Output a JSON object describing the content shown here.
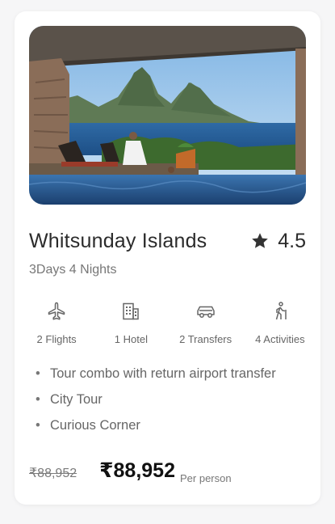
{
  "tour": {
    "title": "Whitsunday Islands",
    "rating": "4.5",
    "duration": "3Days 4 Nights"
  },
  "features": [
    {
      "icon": "airplane-icon",
      "label": "2 Flights"
    },
    {
      "icon": "hotel-icon",
      "label": "1 Hotel"
    },
    {
      "icon": "car-icon",
      "label": "2 Transfers"
    },
    {
      "icon": "hiking-icon",
      "label": "4 Activities"
    }
  ],
  "highlights": [
    "Tour combo with return airport transfer",
    "City Tour",
    "Curious Corner"
  ],
  "pricing": {
    "original": "₹88,952",
    "current": "₹88,952",
    "unit": "Per person"
  },
  "colors": {
    "text_primary": "#2b2b2b",
    "text_secondary": "#777777",
    "price": "#111111",
    "card_bg": "#ffffff",
    "page_bg": "#f6f6f7"
  }
}
